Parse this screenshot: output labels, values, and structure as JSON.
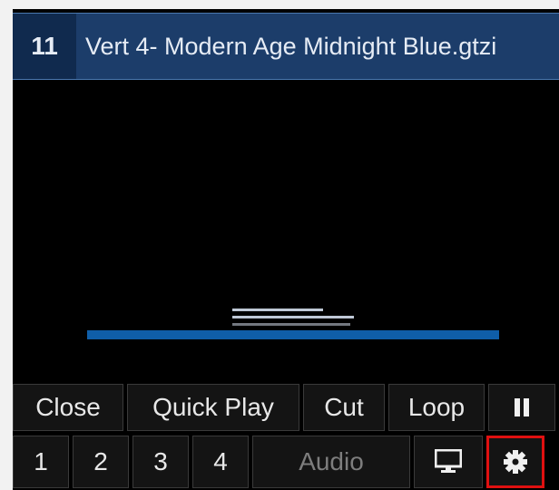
{
  "clip": {
    "number": "11",
    "title": "Vert 4- Modern Age Midnight Blue.gtzi"
  },
  "buttons_row1": {
    "close": "Close",
    "quick_play": "Quick Play",
    "cut": "Cut",
    "loop": "Loop"
  },
  "buttons_row2": {
    "out1": "1",
    "out2": "2",
    "out3": "3",
    "out4": "4",
    "audio": "Audio"
  },
  "icons": {
    "pause": "pause-icon",
    "monitor": "monitor-icon",
    "settings": "gear-icon"
  },
  "colors": {
    "title_bar": "#1c3d6a",
    "accent_bar": "#0f5ea8",
    "highlight": "#e01010"
  }
}
